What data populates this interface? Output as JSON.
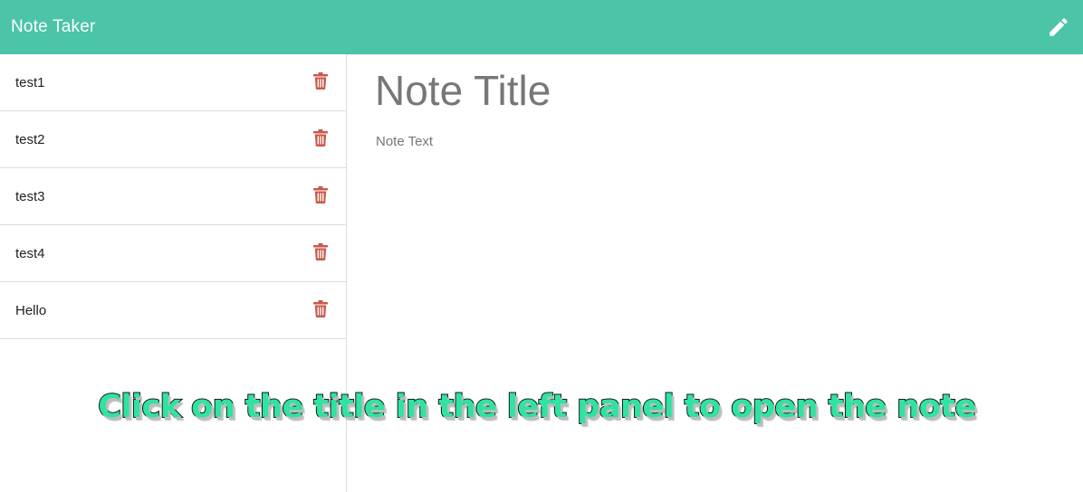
{
  "navbar": {
    "brand": "Note Taker",
    "new_note_icon": "pencil-icon"
  },
  "colors": {
    "navbar_bg": "#4bc4a8",
    "delete_icon": "#c9594c",
    "caption_fill": "#2fe3a0"
  },
  "notes": [
    {
      "title": "test1",
      "delete_icon": "trash-icon"
    },
    {
      "title": "test2",
      "delete_icon": "trash-icon"
    },
    {
      "title": "test3",
      "delete_icon": "trash-icon"
    },
    {
      "title": "test4",
      "delete_icon": "trash-icon"
    },
    {
      "title": "Hello",
      "delete_icon": "trash-icon"
    }
  ],
  "editor": {
    "title_placeholder": "Note Title",
    "title_value": "",
    "text_placeholder": "Note Text",
    "text_value": ""
  },
  "caption": "Click on the title in the left panel to open the note"
}
